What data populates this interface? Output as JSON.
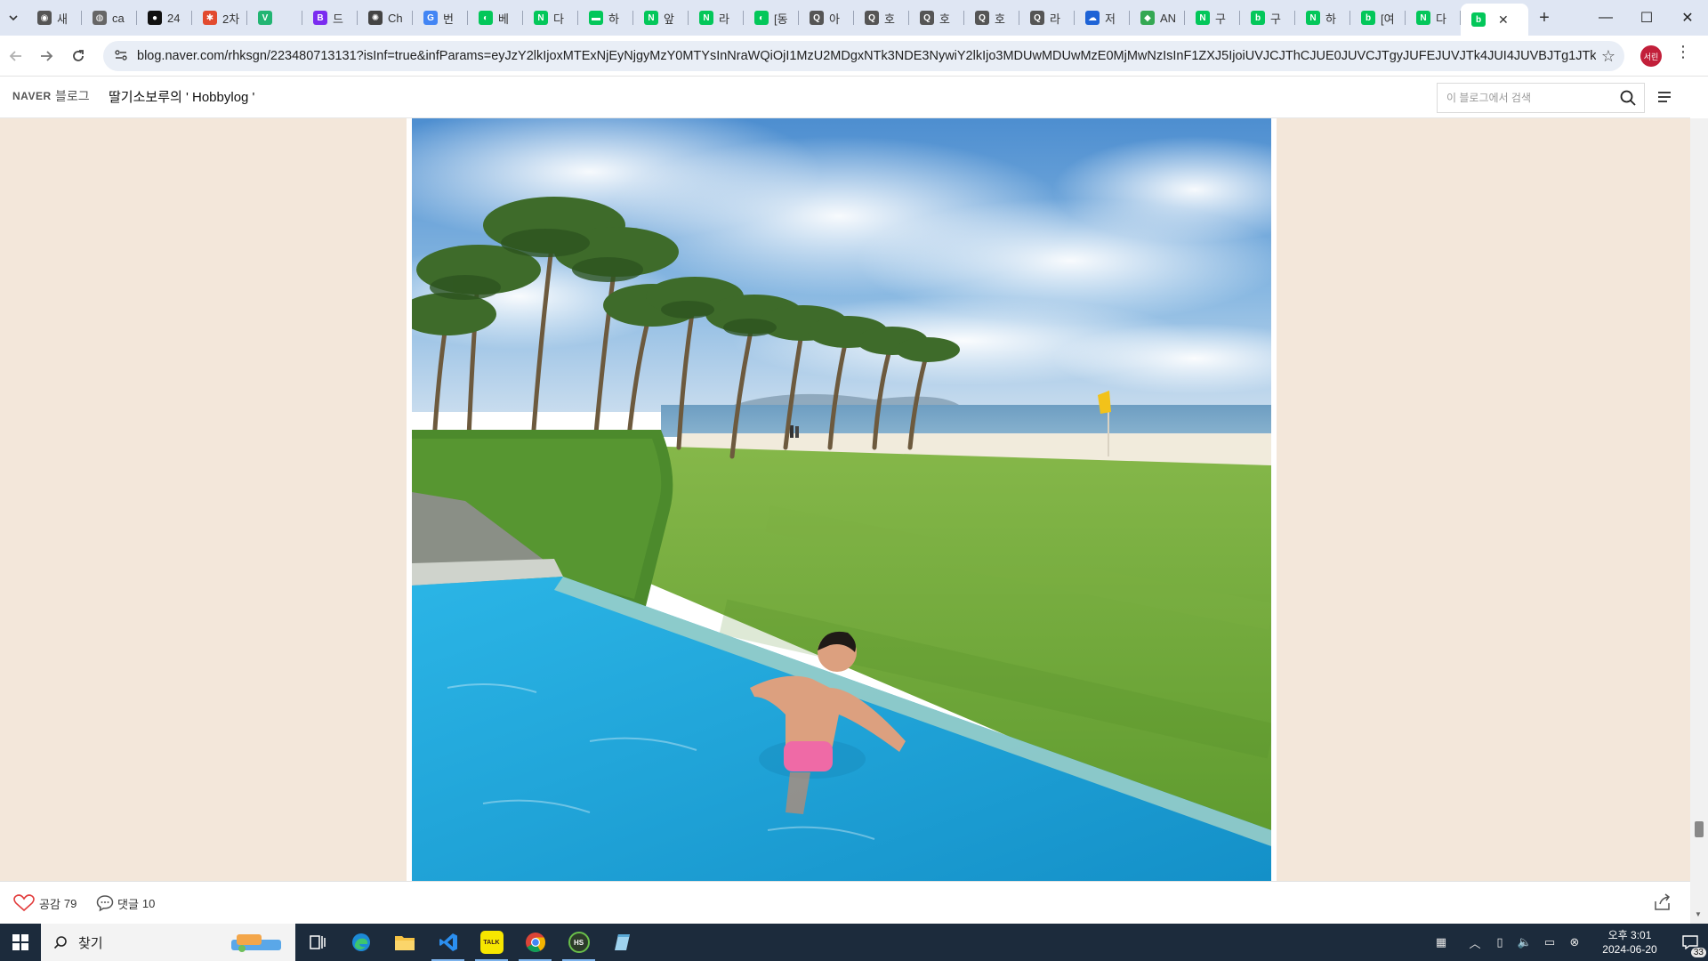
{
  "browser": {
    "tabs": [
      {
        "label": "새",
        "icon": "chrome-icon",
        "color": "#555555"
      },
      {
        "label": "ca",
        "icon": "globe-icon",
        "color": "#666666"
      },
      {
        "label": "24",
        "icon": "github-icon",
        "color": "#111111"
      },
      {
        "label": "2차",
        "icon": "figma-icon",
        "color": "#e24a2e"
      },
      {
        "label": "",
        "icon": "v-icon",
        "color": "#22b573"
      },
      {
        "label": "드",
        "icon": "b-icon",
        "color": "#7b2cf0"
      },
      {
        "label": "Ch",
        "icon": "openai-icon",
        "color": "#444444"
      },
      {
        "label": "번",
        "icon": "google-icon",
        "color": "#4285f4"
      },
      {
        "label": "베",
        "icon": "cookie-icon",
        "color": "#03c75a"
      },
      {
        "label": "다",
        "icon": "naver-icon",
        "color": "#03c75a"
      },
      {
        "label": "하",
        "icon": "chat-icon",
        "color": "#03c75a"
      },
      {
        "label": "앞",
        "icon": "naver-icon",
        "color": "#03c75a"
      },
      {
        "label": "라",
        "icon": "naver-icon",
        "color": "#03c75a"
      },
      {
        "label": "[동",
        "icon": "cookie-icon",
        "color": "#03c75a"
      },
      {
        "label": "아",
        "icon": "search-q-icon",
        "color": "#555555"
      },
      {
        "label": "호",
        "icon": "search-q-icon",
        "color": "#555555"
      },
      {
        "label": "호",
        "icon": "search-q-icon",
        "color": "#555555"
      },
      {
        "label": "호",
        "icon": "search-q-icon",
        "color": "#555555"
      },
      {
        "label": "라",
        "icon": "search-q-icon",
        "color": "#555555"
      },
      {
        "label": "저",
        "icon": "cloud-icon",
        "color": "#1e63d6"
      },
      {
        "label": "AN",
        "icon": "maps-icon",
        "color": "#34a853"
      },
      {
        "label": "구",
        "icon": "naver-icon",
        "color": "#03c75a"
      },
      {
        "label": "구",
        "icon": "blog-icon",
        "color": "#03c75a"
      },
      {
        "label": "하",
        "icon": "naver-icon",
        "color": "#03c75a"
      },
      {
        "label": "[여",
        "icon": "blog-icon",
        "color": "#03c75a"
      },
      {
        "label": "다",
        "icon": "naver-icon",
        "color": "#03c75a"
      }
    ],
    "active_tab": {
      "label": "",
      "icon": "blog-icon",
      "color": "#03c75a"
    },
    "new_tab": "+",
    "url": "blog.naver.com/rhksgn/223480713131?isInf=true&infParams=eyJzY2lkIjoxMTExNjEyNjgyMzY0MTYsInNraWQiOjI1MzU2MDgxNTk3NDE3NywiY2lkIjo3MDUwMDUwMzE0MjMwNzIsInF1ZXJ5IjoiUVJCJThCJUE0JUVCJTgyJUFEJUVJTk4JUI4JUVBJTg1JTk0In0=&tracki...",
    "profile_initials": "서린",
    "minimize": "—",
    "maximize": "☐",
    "close": "✕"
  },
  "blog": {
    "naver_logo": "NAVER",
    "blog_label": "블로그",
    "title": "딸기소보루의 ' Hobbylog '",
    "search_placeholder": "이 블로그에서 검색",
    "like_label": "공감",
    "like_count": "79",
    "comment_label": "댓글",
    "comment_count": "10",
    "photo": {
      "subject": "person-in-infinity-pool",
      "sky_color": "#6fa6d8",
      "grass_color": "#6ea43a",
      "pool_color": "#1ea4da",
      "flag_color": "#f2c21a"
    },
    "background_color": "#f3e7da"
  },
  "taskbar": {
    "search_label": "찾기",
    "apps": [
      "task-view-icon",
      "edge-icon",
      "file-explorer-icon",
      "vscode-icon",
      "kakaotalk-icon",
      "chrome-icon",
      "hs-icon",
      "notepad-icon"
    ],
    "kakaotalk_label": "TALK",
    "hs_label": "HS",
    "clock_time": "오후 3:01",
    "clock_date": "2024-06-20",
    "notification_count": "33"
  }
}
